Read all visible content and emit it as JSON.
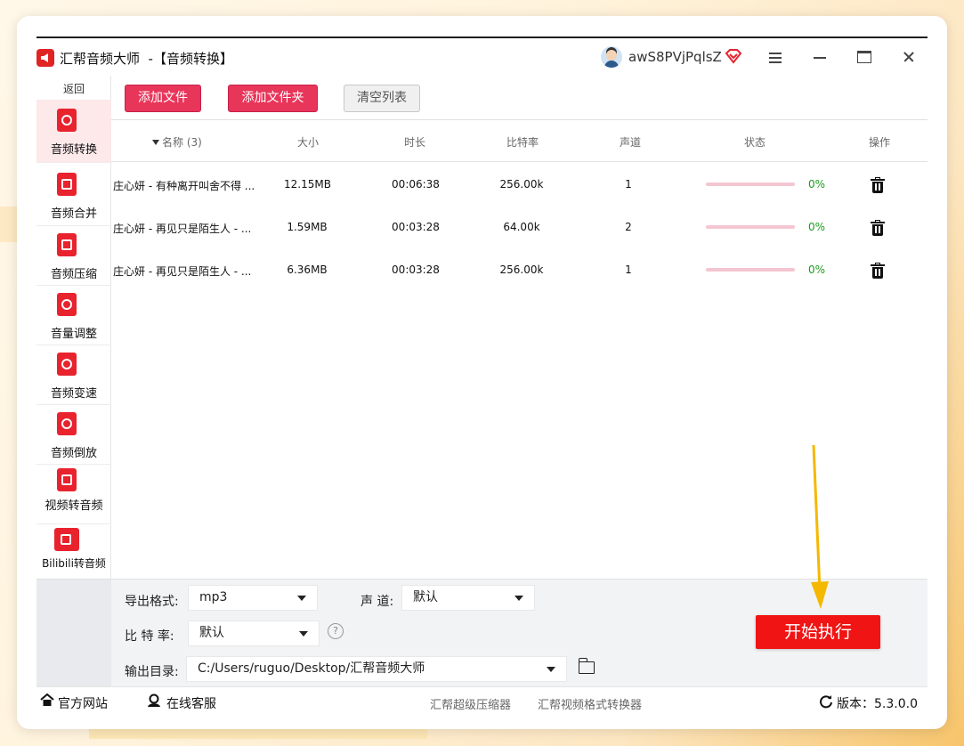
{
  "window": {
    "title": "汇帮音频大师  -【音频转换】",
    "username": "awS8PVjPqlsZ"
  },
  "sidebar": {
    "back": "返回",
    "items": [
      {
        "label": "音频转换",
        "icon": "audio-convert-icon"
      },
      {
        "label": "音频合并",
        "icon": "audio-merge-icon"
      },
      {
        "label": "音频压缩",
        "icon": "audio-compress-icon"
      },
      {
        "label": "音量调整",
        "icon": "volume-icon"
      },
      {
        "label": "音频变速",
        "icon": "microphone-icon"
      },
      {
        "label": "音频倒放",
        "icon": "music-note-icon"
      },
      {
        "label": "视频转音频",
        "icon": "video-film-icon"
      },
      {
        "label": "Bilibili转音频",
        "icon": "bilibili-tv-icon"
      }
    ]
  },
  "toolbar": {
    "add_file": "添加文件",
    "add_folder": "添加文件夹",
    "clear_list": "清空列表"
  },
  "table": {
    "columns": {
      "name": "名称 (3)",
      "size": "大小",
      "duration": "时长",
      "bitrate": "比特率",
      "channels": "声道",
      "status": "状态",
      "action": "操作"
    },
    "rows": [
      {
        "name": "庄心妍 - 有种离开叫舍不得 ...",
        "size": "12.15MB",
        "duration": "00:06:38",
        "bitrate": "256.00k",
        "channels": "1",
        "progress_pct": "0%"
      },
      {
        "name": "庄心妍 - 再见只是陌生人 - ...",
        "size": "1.59MB",
        "duration": "00:03:28",
        "bitrate": "64.00k",
        "channels": "2",
        "progress_pct": "0%"
      },
      {
        "name": "庄心妍 - 再见只是陌生人 - ...",
        "size": "6.36MB",
        "duration": "00:03:28",
        "bitrate": "256.00k",
        "channels": "1",
        "progress_pct": "0%"
      }
    ]
  },
  "settings": {
    "format_label": "导出格式:",
    "format_value": "mp3",
    "channel_label": "声 道:",
    "channel_value": "默认",
    "bitrate_label": "比 特 率:",
    "bitrate_value": "默认",
    "help": "?",
    "output_label": "输出目录:",
    "output_value": "C:/Users/ruguo/Desktop/汇帮音频大师",
    "start": "开始执行"
  },
  "statusbar": {
    "website": "官方网站",
    "support": "在线客服",
    "link1": "汇帮超级压缩器",
    "link2": "汇帮视频格式转换器",
    "version": "版本：5.3.0.0"
  },
  "colors": {
    "accent_red": "#e8355a",
    "start_red": "#f01414",
    "progress_track": "#f3c6d1",
    "progress_text": "#1e9a1e",
    "annotation_arrow": "#f5b800"
  }
}
